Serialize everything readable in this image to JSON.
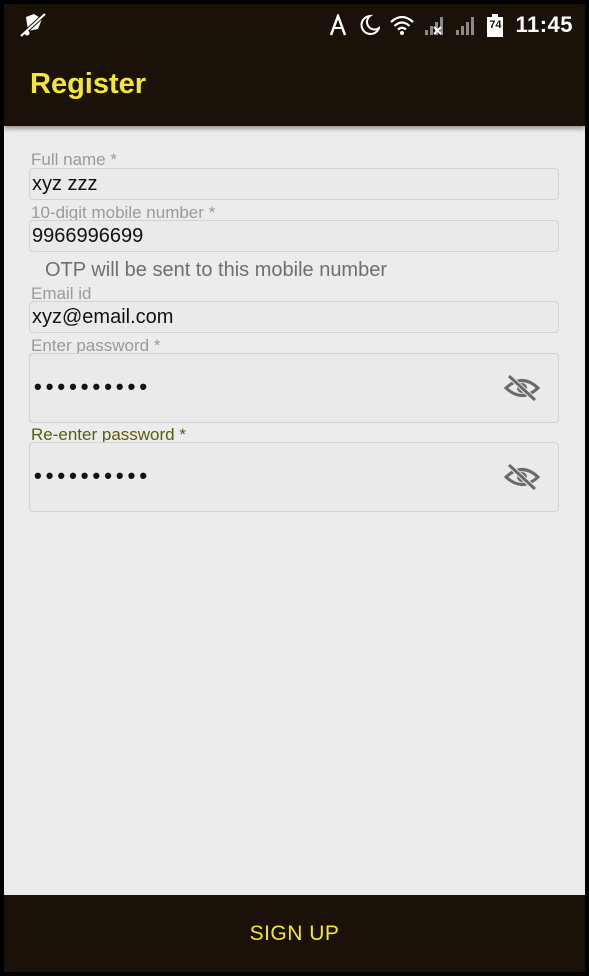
{
  "status_bar": {
    "time": "11:45",
    "battery_level": "74",
    "icons": [
      "notifications-muted-icon",
      "auto-brightness-icon",
      "do-not-disturb-moon-icon",
      "wifi-icon",
      "signal-no-sim-icon",
      "signal-icon",
      "battery-icon"
    ]
  },
  "app_bar": {
    "title": "Register"
  },
  "form": {
    "full_name": {
      "label": "Full name *",
      "value": "xyz zzz"
    },
    "mobile": {
      "label": "10-digit mobile number *",
      "value": "9966996699",
      "hint": "OTP will be sent to this mobile number"
    },
    "email": {
      "label": "Email id",
      "value": "xyz@email.com"
    },
    "password": {
      "label": "Enter password *",
      "value": "••••••••••",
      "toggle_icon": "eye-off-icon"
    },
    "confirm_password": {
      "label": "Re-enter password *",
      "value": "••••••••••",
      "toggle_icon": "eye-off-icon"
    }
  },
  "actions": {
    "signup_label": "SIGN UP"
  },
  "colors": {
    "app_bar_bg": "#1a1108",
    "accent": "#f5e633",
    "background": "#ececec",
    "focused_label": "#5a5a10"
  }
}
